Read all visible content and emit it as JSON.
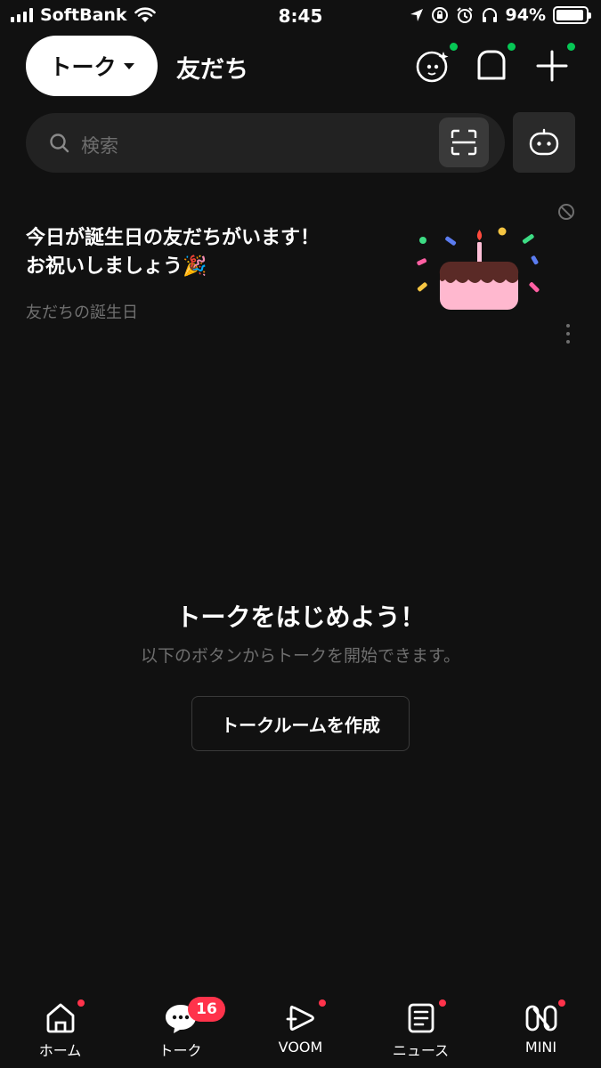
{
  "status_bar": {
    "carrier": "SoftBank",
    "time": "8:45",
    "battery_text": "94%",
    "battery_level": 0.94
  },
  "header": {
    "talk_tab": "トーク",
    "friends_tab": "友だち",
    "icons": [
      "face-sparkle-icon",
      "chat-bubble-icon",
      "plus-icon"
    ],
    "notify_color": "#06c755"
  },
  "search": {
    "placeholder": "検索"
  },
  "birthday": {
    "line1": "今日が誕生日の友だちがいます！",
    "line2": "お祝いしましょう",
    "emoji": "🎉",
    "caption": "友だちの誕生日"
  },
  "empty_state": {
    "title": "トークをはじめよう！",
    "description": "以下のボタンからトークを開始できます。",
    "button": "トークルームを作成"
  },
  "tab_bar": {
    "items": [
      {
        "label": "ホーム",
        "icon": "home-icon"
      },
      {
        "label": "トーク",
        "icon": "chat-icon",
        "badge": "16"
      },
      {
        "label": "VOOM",
        "icon": "voom-icon"
      },
      {
        "label": "ニュース",
        "icon": "news-icon"
      },
      {
        "label": "MINI",
        "icon": "mini-icon"
      }
    ],
    "alert_color": "#ff334b"
  }
}
